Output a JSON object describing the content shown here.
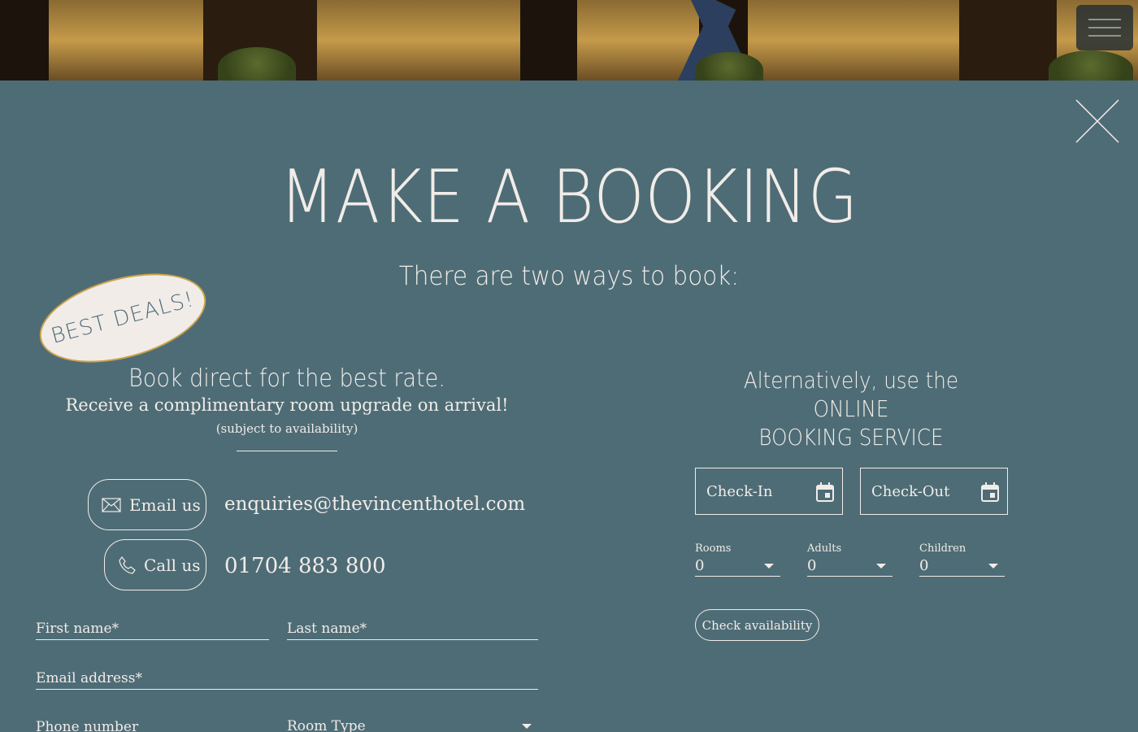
{
  "header": {
    "menu_icon": "hamburger-icon"
  },
  "modal": {
    "close_icon": "close-icon",
    "title": "MAKE A BOOKING",
    "subtitle": "There are two ways to book:",
    "badge": "BEST DEALS!"
  },
  "direct": {
    "headline": "Book direct for the best rate.",
    "upgrade": "Receive a complimentary room upgrade on arrival!",
    "availability": "(subject to availability)",
    "email_button": "Email us",
    "email_address": "enquiries@thevincenthotel.com",
    "call_button": "Call us",
    "phone": "01704 883 800",
    "form": {
      "first_name": "First name*",
      "last_name": "Last name*",
      "email": "Email address*",
      "phone": "Phone number",
      "room_type": "Room Type"
    }
  },
  "online": {
    "headline_line1": "Alternatively, use the ONLINE",
    "headline_line2": "BOOKING SERVICE",
    "check_in": "Check-In",
    "check_out": "Check-Out",
    "rooms_label": "Rooms",
    "rooms_value": "0",
    "adults_label": "Adults",
    "adults_value": "0",
    "children_label": "Children",
    "children_value": "0",
    "check_button": "Check availability"
  },
  "colors": {
    "background": "#4e6c76",
    "text": "#f1ece8",
    "badge_border": "#c9a24a"
  }
}
